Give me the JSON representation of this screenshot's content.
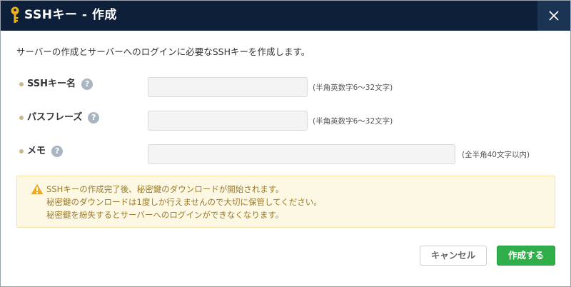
{
  "dialog": {
    "title": "SSHキー - 作成",
    "title_icon": "key-icon",
    "close_icon": "close-icon"
  },
  "intro_text": "サーバーの作成とサーバーへのログインに必要なSSHキーを作成します。",
  "form": {
    "fields": [
      {
        "label": "SSHキー名",
        "help": "?",
        "value": "",
        "hint": "(半角英数字6～32文字)"
      },
      {
        "label": "パスフレーズ",
        "help": "?",
        "value": "",
        "hint": "(半角英数字6～32文字)"
      },
      {
        "label": "メモ",
        "help": "?",
        "value": "",
        "hint": "(全半角40文字以内)"
      }
    ]
  },
  "notice": {
    "icon": "warning-icon",
    "lines": [
      "SSHキーの作成完了後、秘密鍵のダウンロードが開始されます。",
      "秘密鍵のダウンロードは1度しか行えませんので大切に保管してください。",
      "秘密鍵を紛失するとサーバーへのログインができなくなります。"
    ]
  },
  "buttons": {
    "cancel": "キャンセル",
    "create": "作成する"
  },
  "colors": {
    "titlebar": "#0e1f3a",
    "primary_button": "#2fae4a",
    "notice_background": "#fdf8e4",
    "notice_text": "#9a7a2a"
  }
}
